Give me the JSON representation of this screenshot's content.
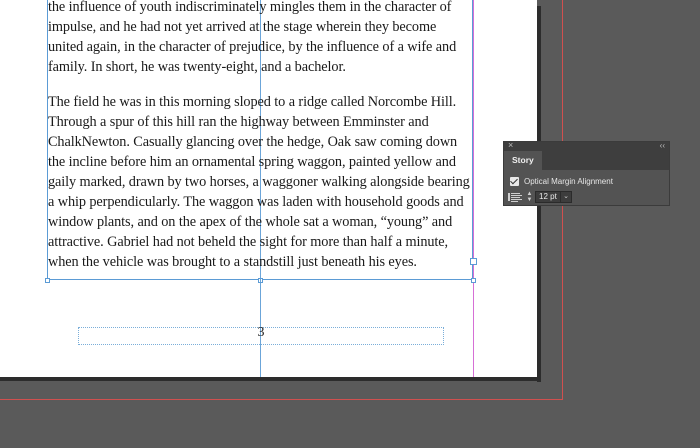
{
  "story": {
    "paragraphs": [
      {
        "lines": [
          "the influence of youth indiscriminately mingles them in the character of",
          "impulse, and he had not yet arrived at the stage wherein they become",
          "united again, in the character of prejudice, by the influence of a wife and",
          "family. In short, he was twenty-eight, and a bachelor."
        ]
      },
      {
        "lines": [
          "The field he was in this morning sloped to a ridge called Norcombe Hill.",
          "Through a spur of this hill ran the highway between Emminster and",
          "ChalkNewton. Casually glancing over the hedge, Oak saw coming down",
          "the incline before him an ornamental spring waggon, painted yellow and",
          "gaily marked, drawn by two horses, a waggoner walking alongside bearing",
          "a whip perpendicularly. The waggon was laden with household goods and",
          "window plants, and on the apex of the whole sat a woman, “young” and",
          "attractive. Gabriel had not beheld the sight for more than half a minute,",
          "when the vehicle was brought to a standstill just beneath his eyes."
        ]
      }
    ]
  },
  "folio": {
    "page_number": "3"
  },
  "panel": {
    "close_glyph": "×",
    "collapse_glyph": "‹‹",
    "tab_label": "Story",
    "optical_margin_label": "Optical Margin Alignment",
    "optical_margin_checked": true,
    "size_value": "12 pt",
    "stepper_up": "▲",
    "stepper_down": "▼",
    "dropdown_glyph": "⌄",
    "icons": {
      "alignment": "optical-margin-size-icon"
    }
  },
  "colors": {
    "pasteboard": "#5a5a5a",
    "bleed_guide": "#d0504f",
    "margin_guide": "#d66fd6",
    "frame_guide": "#5b9bd5",
    "panel_bg": "#535353"
  }
}
